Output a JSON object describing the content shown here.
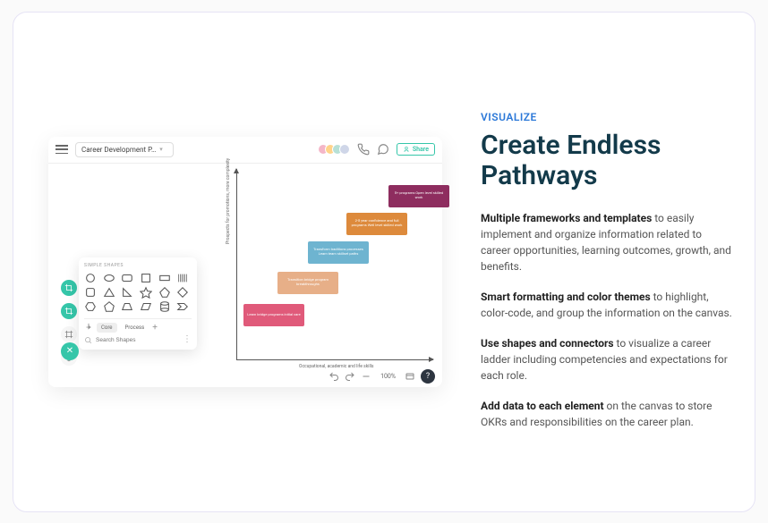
{
  "marketing": {
    "eyebrow": "VISUALIZE",
    "heading": "Create Endless Pathways",
    "paragraphs": [
      {
        "bold": "Multiple frameworks and templates",
        "rest": " to easily implement and organize information related to career opportunities, learning outcomes, growth, and benefits."
      },
      {
        "bold": "Smart formatting and color themes",
        "rest": " to highlight, color-code, and group the information on the canvas."
      },
      {
        "bold": "Use shapes and connectors",
        "rest": " to visualize a career ladder including competencies and expectations for each role."
      },
      {
        "bold": "Add data to each element",
        "rest": " on the canvas to store OKRs and responsibilities on the career plan."
      }
    ]
  },
  "app": {
    "doc_title": "Career Development P…",
    "share_label": "Share",
    "avatars": [
      "#f4b6c8",
      "#ffd38a",
      "#b7e0d6",
      "#cfd6e8"
    ],
    "axis": {
      "y_label": "Prospects for promotions, more complexity",
      "x_label": "Occupational, academic and life skills"
    },
    "blocks": {
      "b1": "5+ programs Open level skilled work",
      "b2": "2-5 year confidence and full programs Well level skilled work",
      "b3": "Transform traditions processes Learn team skillset paths",
      "b4": "Transition bridge program breakthroughs",
      "b5": "Learn bridge programs initial care",
      "colors": {
        "b1": "#8e2d5f",
        "b2": "#dd8a3c",
        "b3": "#6eb4d0",
        "b4": "#e7af88",
        "b5": "#e05a7a"
      }
    },
    "shape_panel": {
      "title": "SIMPLE SHAPES",
      "tabs": {
        "active": "Core",
        "other": "Process"
      },
      "search_placeholder": "Search Shapes"
    },
    "footer": {
      "zoom": "100%",
      "help": "?"
    },
    "icons": {
      "hamburger": "hamburger-icon",
      "phone": "phone-icon",
      "comment": "comment-icon",
      "share_lead": "user-plus-icon",
      "rail_crop1": "crop-icon",
      "rail_crop2": "crop-icon",
      "rail_frame": "frame-icon",
      "rail_cluster": "cluster-icon",
      "close": "close-icon",
      "search": "search-icon",
      "kebab": "kebab-icon",
      "undo": "undo-icon",
      "redo": "redo-icon",
      "minus": "minus-icon",
      "plus": "plus-icon",
      "layers": "layers-icon"
    }
  }
}
